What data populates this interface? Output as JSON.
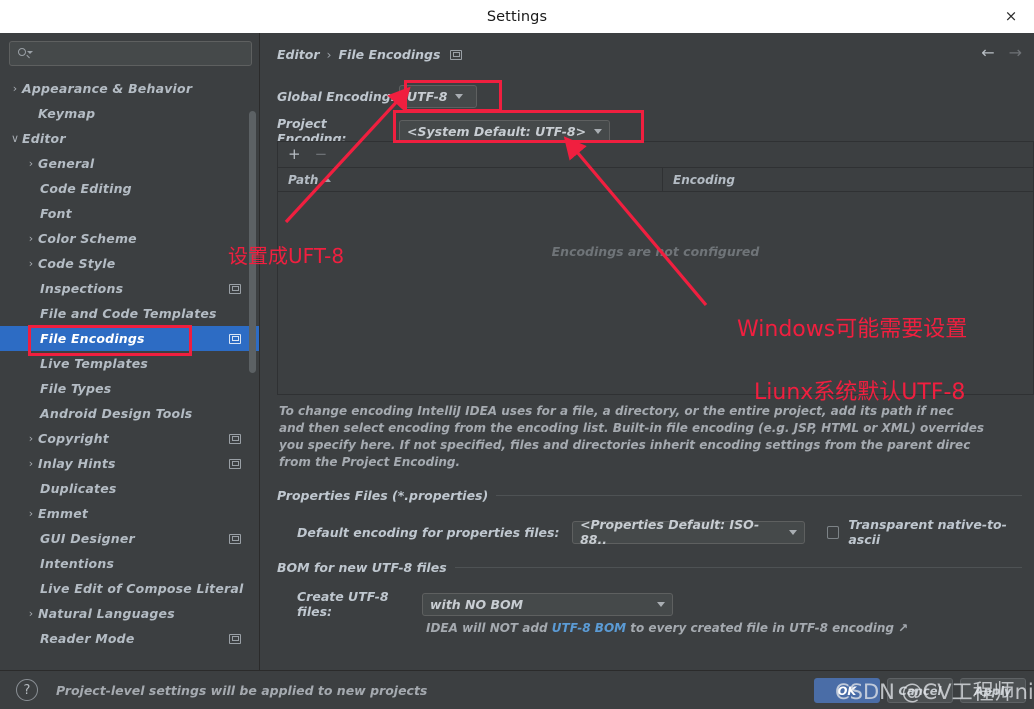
{
  "window": {
    "title": "Settings",
    "close_label": "×"
  },
  "sidebar": {
    "search": {
      "value": "",
      "placeholder": ""
    },
    "items": [
      {
        "label": "Appearance & Behavior",
        "indent": 0,
        "twisty": "›",
        "badge": false,
        "selected": false
      },
      {
        "label": "Keymap",
        "indent": 1,
        "twisty": "",
        "badge": false,
        "selected": false
      },
      {
        "label": "Editor",
        "indent": 0,
        "twisty": "∨",
        "badge": false,
        "selected": false
      },
      {
        "label": "General",
        "indent": 1,
        "twisty": "›",
        "badge": false,
        "selected": false
      },
      {
        "label": "Code Editing",
        "indent": 2,
        "twisty": "",
        "badge": false,
        "selected": false
      },
      {
        "label": "Font",
        "indent": 2,
        "twisty": "",
        "badge": false,
        "selected": false
      },
      {
        "label": "Color Scheme",
        "indent": 1,
        "twisty": "›",
        "badge": false,
        "selected": false
      },
      {
        "label": "Code Style",
        "indent": 1,
        "twisty": "›",
        "badge": false,
        "selected": false
      },
      {
        "label": "Inspections",
        "indent": 2,
        "twisty": "",
        "badge": true,
        "selected": false
      },
      {
        "label": "File and Code Templates",
        "indent": 2,
        "twisty": "",
        "badge": false,
        "selected": false
      },
      {
        "label": "File Encodings",
        "indent": 2,
        "twisty": "",
        "badge": true,
        "selected": true
      },
      {
        "label": "Live Templates",
        "indent": 2,
        "twisty": "",
        "badge": false,
        "selected": false
      },
      {
        "label": "File Types",
        "indent": 2,
        "twisty": "",
        "badge": false,
        "selected": false
      },
      {
        "label": "Android Design Tools",
        "indent": 2,
        "twisty": "",
        "badge": false,
        "selected": false
      },
      {
        "label": "Copyright",
        "indent": 1,
        "twisty": "›",
        "badge": true,
        "selected": false
      },
      {
        "label": "Inlay Hints",
        "indent": 1,
        "twisty": "›",
        "badge": true,
        "selected": false
      },
      {
        "label": "Duplicates",
        "indent": 2,
        "twisty": "",
        "badge": false,
        "selected": false
      },
      {
        "label": "Emmet",
        "indent": 1,
        "twisty": "›",
        "badge": false,
        "selected": false
      },
      {
        "label": "GUI Designer",
        "indent": 2,
        "twisty": "",
        "badge": true,
        "selected": false
      },
      {
        "label": "Intentions",
        "indent": 2,
        "twisty": "",
        "badge": false,
        "selected": false
      },
      {
        "label": "Live Edit of Compose Literal",
        "indent": 2,
        "twisty": "",
        "badge": false,
        "selected": false
      },
      {
        "label": "Natural Languages",
        "indent": 1,
        "twisty": "›",
        "badge": false,
        "selected": false
      },
      {
        "label": "Reader Mode",
        "indent": 2,
        "twisty": "",
        "badge": true,
        "selected": false
      }
    ]
  },
  "main": {
    "breadcrumb": {
      "parent": "Editor",
      "separator": "›",
      "current": "File Encodings"
    },
    "nav": {
      "back": "←",
      "forward": "→"
    },
    "global_encoding": {
      "label": "Global Encoding:",
      "value": "UTF-8"
    },
    "project_encoding": {
      "label": "Project Encoding:",
      "value": "<System Default: UTF-8>"
    },
    "table": {
      "add_label": "+",
      "remove_label": "−",
      "columns": [
        "Path",
        "Encoding"
      ],
      "empty_text": "Encodings are not configured",
      "rows": []
    },
    "description": "To change encoding IntelliJ IDEA uses for a file, a directory, or the entire project, add its path if nec\nand then select encoding from the encoding list. Built-in file encoding (e.g. JSP, HTML or XML) overrides\nyou specify here. If not specified, files and directories inherit encoding settings from the parent direc\nfrom the Project Encoding.",
    "properties_section": {
      "title": "Properties Files (*.properties)",
      "default_encoding_label": "Default encoding for properties files:",
      "default_encoding_value": "<Properties Default: ISO-88..",
      "transparent_label": "Transparent native-to-ascii",
      "transparent_checked": false
    },
    "bom_section": {
      "title": "BOM for new UTF-8 files",
      "create_label": "Create UTF-8 files:",
      "create_value": "with NO BOM",
      "note_prefix": "IDEA will NOT add ",
      "note_highlight": "UTF-8 BOM",
      "note_suffix": " to every created file in UTF-8 encoding ↗"
    }
  },
  "bottom": {
    "help_label": "?",
    "note": "Project-level settings will be applied to new projects",
    "buttons": [
      {
        "label": "OK",
        "style": "primary"
      },
      {
        "label": "Cancel",
        "style": "normal"
      },
      {
        "label": "Apply",
        "style": "normal"
      }
    ]
  },
  "annotations": {
    "color": "#f01f3f",
    "texts": [
      {
        "text": "设置成UFT-8"
      },
      {
        "text": "Windows可能需要设置"
      },
      {
        "text": "Liunx系统默认UTF-8"
      }
    ]
  },
  "watermark": {
    "text": "CSDN @CV工程师niko"
  }
}
